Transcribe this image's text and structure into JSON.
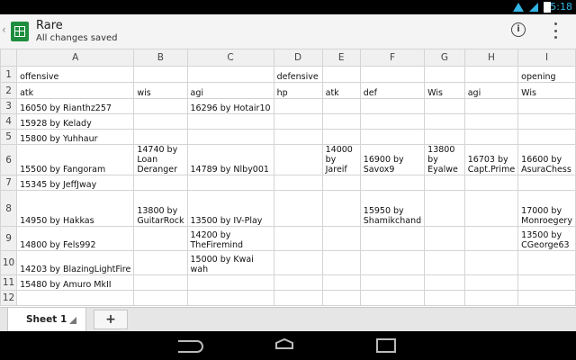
{
  "status_bar": {
    "time": "5:18",
    "icons": [
      "wifi-icon",
      "signal-icon",
      "battery-icon"
    ],
    "accent_color": "#33b5e5"
  },
  "app_bar": {
    "title": "Rare",
    "subtitle": "All changes saved",
    "back_glyph": "‹",
    "info_glyph": "i",
    "brand_color": "#1e8e3e"
  },
  "sheet": {
    "columns": [
      "A",
      "B",
      "C",
      "D",
      "E",
      "F",
      "G",
      "H",
      "I"
    ],
    "rows": [
      {
        "num": "1",
        "cells": [
          "offensive",
          "",
          "",
          "defensive",
          "",
          "",
          "",
          "",
          "opening"
        ]
      },
      {
        "num": "2",
        "cells": [
          "atk",
          "wis",
          "agi",
          "hp",
          "atk",
          "def",
          "Wis",
          "agi",
          "Wis"
        ]
      },
      {
        "num": "3",
        "cells": [
          "16050 by Rianthz257",
          "",
          "16296 by Hotair10",
          "",
          "",
          "",
          "",
          "",
          ""
        ]
      },
      {
        "num": "4",
        "cells": [
          "15928 by Kelady",
          "",
          "",
          "",
          "",
          "",
          "",
          "",
          ""
        ]
      },
      {
        "num": "5",
        "cells": [
          "15800 by Yuhhaur",
          "",
          "",
          "",
          "",
          "",
          "",
          "",
          ""
        ]
      },
      {
        "num": "6",
        "cells": [
          "15500 by Fangoram",
          "14740 by Loan Deranger",
          "14789 by Nlby001",
          "",
          "14000 by Jareif",
          "16900 by Savox9",
          "13800 by Eyalwe",
          "16703 by Capt.Prime",
          "16600 by AsuraChess"
        ]
      },
      {
        "num": "7",
        "cells": [
          "15345 by JeffJway",
          "",
          "",
          "",
          "",
          "",
          "",
          "",
          ""
        ]
      },
      {
        "num": "8",
        "cells": [
          "14950 by Hakkas",
          "13800 by GuitarRock",
          "13500 by IV-Play",
          "",
          "",
          "15950 by Shamikchand",
          "",
          "",
          "17000 by Monroegery"
        ]
      },
      {
        "num": "9",
        "cells": [
          "14800 by Fels992",
          "",
          "14200 by TheFiremind",
          "",
          "",
          "",
          "",
          "",
          "13500 by CGeorge63"
        ]
      },
      {
        "num": "10",
        "cells": [
          "14203 by BlazingLightFire",
          "",
          "15000 by Kwai wah",
          "",
          "",
          "",
          "",
          "",
          ""
        ]
      },
      {
        "num": "11",
        "cells": [
          "15480 by Amuro MkII",
          "",
          "",
          "",
          "",
          "",
          "",
          "",
          ""
        ]
      },
      {
        "num": "12",
        "cells": [
          "",
          "",
          "",
          "",
          "",
          "",
          "",
          "",
          ""
        ]
      }
    ]
  },
  "tabs": {
    "sheet1_label": "Sheet 1",
    "add_label": "+"
  }
}
